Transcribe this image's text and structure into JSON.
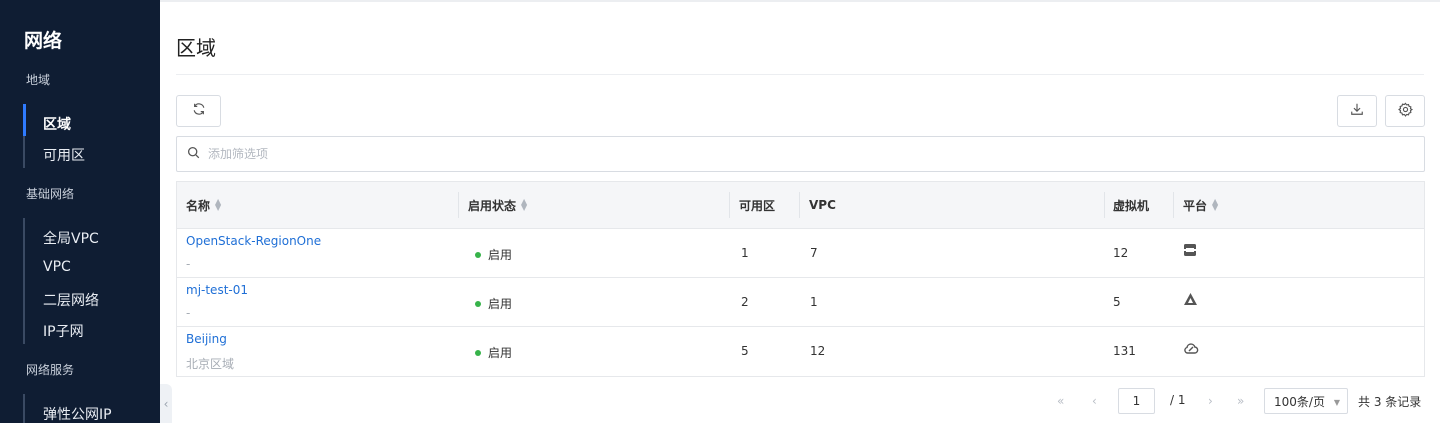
{
  "sidebar": {
    "title": "网络",
    "groups": [
      {
        "label": "地域",
        "items": [
          "区域",
          "可用区"
        ]
      },
      {
        "label": "基础网络",
        "items": [
          "全局VPC",
          "VPC",
          "二层网络",
          "IP子网"
        ]
      },
      {
        "label": "网络服务",
        "items": [
          "弹性公网IP"
        ]
      }
    ],
    "active_item": "区域"
  },
  "page": {
    "title": "区域"
  },
  "toolbar": {
    "refresh_icon": "refresh-icon",
    "download_icon": "download-icon",
    "settings_icon": "gear-icon"
  },
  "search": {
    "placeholder": "添加筛选项"
  },
  "table": {
    "columns": [
      "名称",
      "启用状态",
      "可用区",
      "VPC",
      "虚拟机",
      "平台"
    ],
    "rows": [
      {
        "name": "OpenStack-RegionOne",
        "desc": "-",
        "status": "启用",
        "zones": "1",
        "vpc": "7",
        "vms": "12",
        "platform_icon": "openstack-icon"
      },
      {
        "name": "mj-test-01",
        "desc": "-",
        "status": "启用",
        "zones": "2",
        "vpc": "1",
        "vms": "5",
        "platform_icon": "platform-triangle-icon"
      },
      {
        "name": "Beijing",
        "desc": "北京区域",
        "status": "启用",
        "zones": "5",
        "vpc": "12",
        "vms": "131",
        "platform_icon": "cloud-icon"
      }
    ],
    "status_color": "#37b34a",
    "link_color": "#1f6fd6"
  },
  "pagination": {
    "current_page": "1",
    "total_pages": "/ 1",
    "page_size": "100条/页",
    "record_count": "共 3 条记录"
  }
}
